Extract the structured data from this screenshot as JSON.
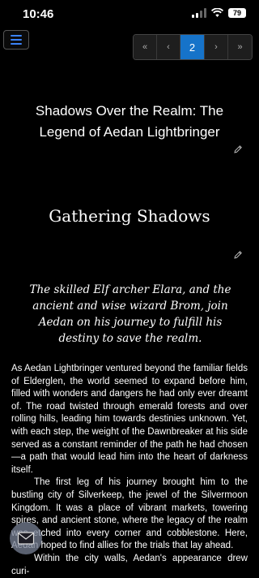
{
  "status_bar": {
    "time": "10:46",
    "battery": "79"
  },
  "pagination": {
    "first": "«",
    "prev": "‹",
    "current": "2",
    "next": "›",
    "last": "»"
  },
  "book": {
    "title": "Shadows Over the Realm: The Legend of Aedan Lightbringer"
  },
  "chapter": {
    "title": "Gathering Shadows",
    "summary": "The skilled Elf archer Elara, and the ancient and wise wizard Brom, join Aedan on his journey to fulfill his destiny to save the realm.",
    "paragraphs": [
      "As Aedan Lightbringer ventured beyond the familiar fields of Elderglen, the world seemed to expand before him, filled with wonders and dangers he had only ever dreamt of. The road twisted through emerald forests and over rolling hills, leading him towards destinies unknown. Yet, with each step, the weight of the Dawnbreaker at his side served as a constant reminder of the path he had chosen—a path that would lead him into the heart of darkness itself.",
      "The first leg of his journey brought him to the bustling city of Silverkeep, the jewel of the Silvermoon Kingdom. It was a place of vibrant markets, towering spires, and ancient stone, where the legacy of the realm was etched into every corner and cobblestone. Here, Aedan hoped to find allies for the trials that lay ahead.",
      "Within the city walls, Aedan's appearance drew curi-"
    ]
  },
  "icons": [
    "menu-icon",
    "edit-icon",
    "mail-icon",
    "wifi-icon",
    "signal-icon",
    "battery-icon"
  ],
  "colors": {
    "accent": "#1673c9",
    "background": "#000000",
    "text": "#ffffff"
  }
}
